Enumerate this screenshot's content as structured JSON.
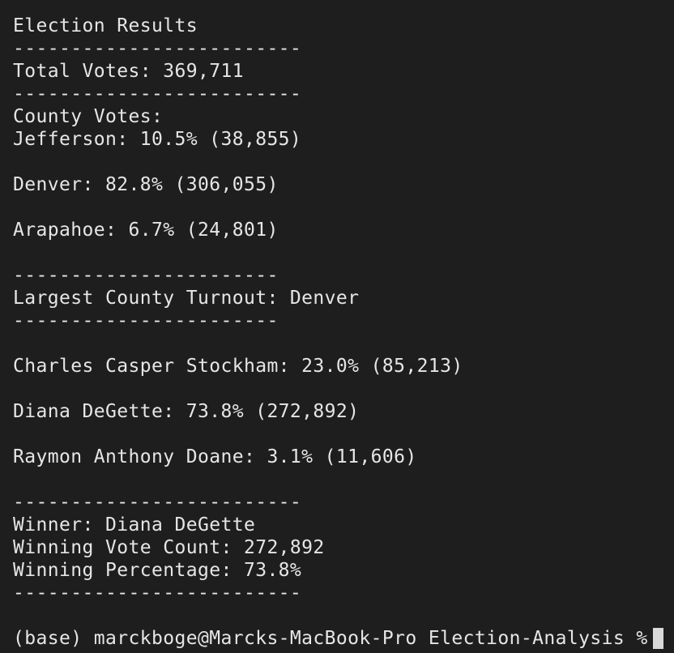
{
  "terminal": {
    "lines": [
      "Election Results",
      "-------------------------",
      "Total Votes: 369,711",
      "-------------------------",
      "County Votes:",
      "Jefferson: 10.5% (38,855)",
      "",
      "Denver: 82.8% (306,055)",
      "",
      "Arapahoe: 6.7% (24,801)",
      "",
      "-----------------------",
      "Largest County Turnout: Denver",
      "-----------------------",
      "",
      "Charles Casper Stockham: 23.0% (85,213)",
      "",
      "Diana DeGette: 73.8% (272,892)",
      "",
      "Raymon Anthony Doane: 3.1% (11,606)",
      "",
      "-------------------------",
      "Winner: Diana DeGette",
      "Winning Vote Count: 272,892",
      "Winning Percentage: 73.8%",
      "-------------------------"
    ],
    "prompt": "(base) marckboge@Marcks-MacBook-Pro Election-Analysis %"
  }
}
